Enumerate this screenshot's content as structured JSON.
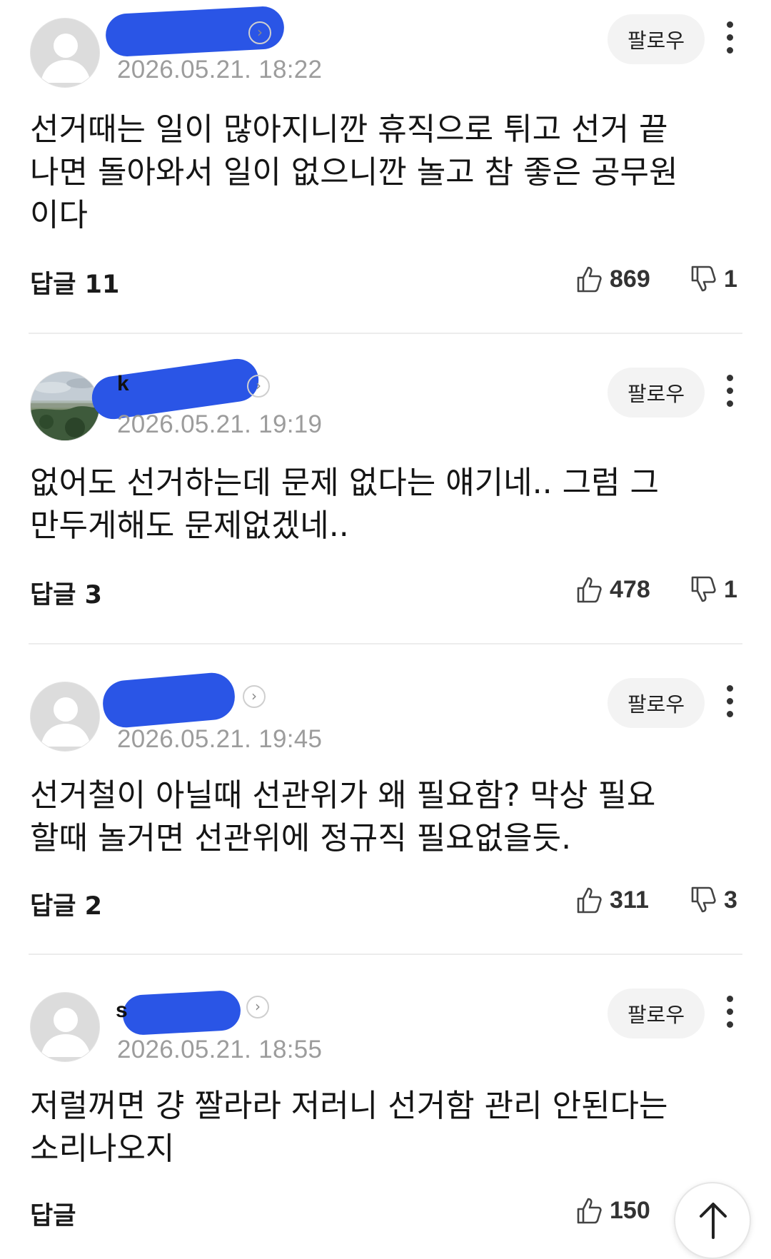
{
  "comments": [
    {
      "username_visible": "",
      "timestamp": "2026.05.21. 18:22",
      "follow_label": "팔로우",
      "text": "선거때는 일이 많아지니깐 휴직으로 튀고 선거 끝\n나면 돌아와서 일이 없으니깐 놀고 참 좋은 공무원\n이다",
      "reply_label": "답글 11",
      "likes": "869",
      "dislikes": "1"
    },
    {
      "username_visible": "k",
      "timestamp": "2026.05.21. 19:19",
      "follow_label": "팔로우",
      "text": "없어도 선거하는데 문제 없다는 얘기네.. 그럼 그\n만두게해도 문제없겠네..",
      "reply_label": "답글 3",
      "likes": "478",
      "dislikes": "1"
    },
    {
      "username_visible": "",
      "timestamp": "2026.05.21. 19:45",
      "follow_label": "팔로우",
      "text": "선거철이 아닐때 선관위가 왜 필요함? 막상 필요\n할때 놀거면 선관위에 정규직 필요없을듯.",
      "reply_label": "답글 2",
      "likes": "311",
      "dislikes": "3"
    },
    {
      "username_visible": "s",
      "timestamp": "2026.05.21. 18:55",
      "follow_label": "팔로우",
      "text": "저럴꺼면 걍 짤라라 저러니 선거함 관리 안된다는\n소리나오지",
      "reply_label": "답글",
      "likes": "150",
      "dislikes": ""
    }
  ],
  "icons": {
    "like": "thumbs-up-icon",
    "dislike": "thumbs-down-icon",
    "more": "more-vertical-icon",
    "profile": "chevron-right-icon",
    "scroll_top": "arrow-up-icon"
  },
  "colors": {
    "redaction": "#2a55e6",
    "timestamp": "#9c9c9c",
    "follow_bg": "#f3f3f3"
  }
}
